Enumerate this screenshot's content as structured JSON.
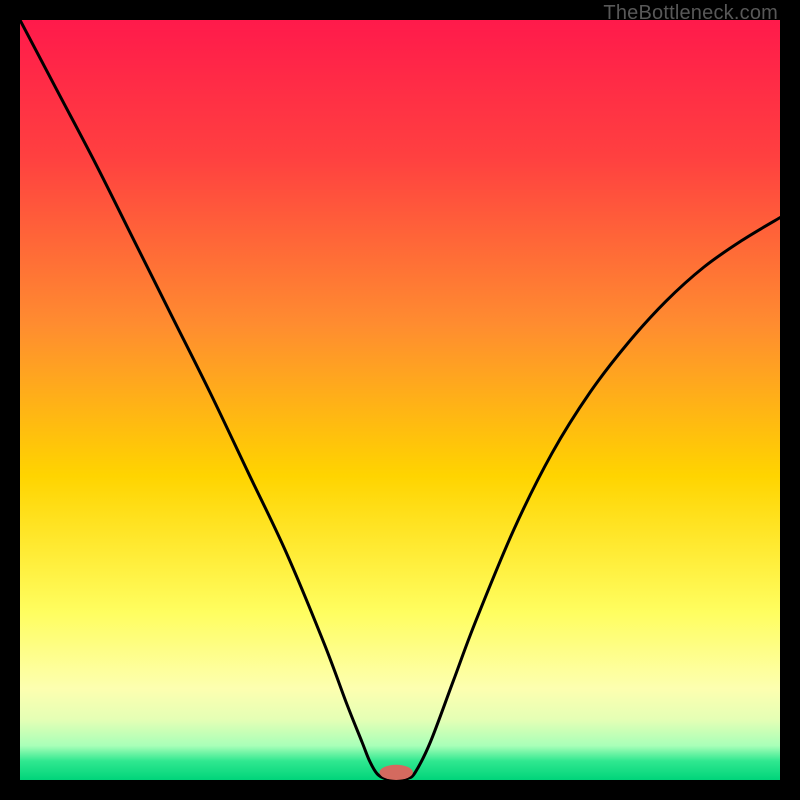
{
  "watermark": "TheBottleneck.com",
  "chart_data": {
    "type": "line",
    "title": "",
    "xlabel": "",
    "ylabel": "",
    "xlim": [
      0,
      1
    ],
    "ylim": [
      0,
      1
    ],
    "background_gradient": {
      "stops": [
        {
          "t": 0.0,
          "color": "#ff1a4b"
        },
        {
          "t": 0.18,
          "color": "#ff4040"
        },
        {
          "t": 0.4,
          "color": "#ff8c30"
        },
        {
          "t": 0.6,
          "color": "#ffd400"
        },
        {
          "t": 0.78,
          "color": "#fffe60"
        },
        {
          "t": 0.88,
          "color": "#fdffb0"
        },
        {
          "t": 0.92,
          "color": "#e5ffb5"
        },
        {
          "t": 0.955,
          "color": "#a8ffb8"
        },
        {
          "t": 0.975,
          "color": "#30e890"
        },
        {
          "t": 1.0,
          "color": "#00d47a"
        }
      ]
    },
    "series": [
      {
        "name": "bottleneck-curve",
        "x": [
          0.0,
          0.05,
          0.1,
          0.15,
          0.2,
          0.25,
          0.3,
          0.35,
          0.4,
          0.43,
          0.45,
          0.46,
          0.47,
          0.48,
          0.49,
          0.5,
          0.51,
          0.52,
          0.54,
          0.57,
          0.6,
          0.65,
          0.7,
          0.75,
          0.8,
          0.85,
          0.9,
          0.95,
          1.0
        ],
        "y": [
          1.0,
          0.905,
          0.81,
          0.71,
          0.61,
          0.51,
          0.405,
          0.3,
          0.18,
          0.1,
          0.05,
          0.025,
          0.008,
          0.002,
          0.0,
          0.0,
          0.002,
          0.01,
          0.05,
          0.13,
          0.21,
          0.33,
          0.43,
          0.51,
          0.575,
          0.63,
          0.675,
          0.71,
          0.74
        ]
      }
    ],
    "marker": {
      "name": "min-marker",
      "x": 0.495,
      "y": 0.0,
      "color": "#d46a5f",
      "rx": 0.022,
      "ry": 0.01
    }
  }
}
